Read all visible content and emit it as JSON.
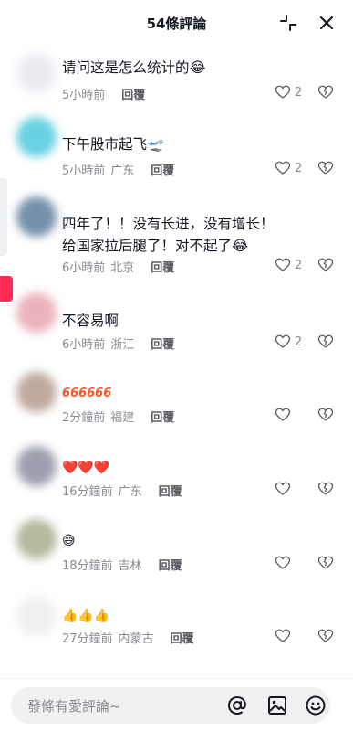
{
  "header": {
    "title": "54條評論"
  },
  "comments": [
    {
      "text": "请问这是怎么统计的😂",
      "time": "5小時前",
      "location": "",
      "reply": "回覆",
      "likes": "2",
      "avatar_color": "#e7e9ee"
    },
    {
      "text": "下午股市起飞🛫",
      "time": "5小時前",
      "location": "广东",
      "reply": "回覆",
      "likes": "2",
      "avatar_color": "#4fc9de"
    },
    {
      "text": "四年了！！没有长进，没有增长！给国家拉后腿了！对不起了😂",
      "time": "6小時前",
      "location": "北京",
      "reply": "回覆",
      "likes": "2",
      "avatar_color": "#5b7d9a"
    },
    {
      "text": "不容易啊",
      "time": "6小時前",
      "location": "浙江",
      "reply": "回覆",
      "likes": "2",
      "avatar_color": "#e8a6b0"
    },
    {
      "text": "666666",
      "time": "2分鐘前",
      "location": "福建",
      "reply": "回覆",
      "likes": "",
      "avatar_color": "#b49b8e"
    },
    {
      "text": "❤️❤️❤️",
      "time": "16分鐘前",
      "location": "广东",
      "reply": "回覆",
      "likes": "",
      "avatar_color": "#8c8fa0"
    },
    {
      "text": "😅",
      "time": "18分鐘前",
      "location": "吉林",
      "reply": "回覆",
      "likes": "",
      "avatar_color": "#a7ae8d"
    },
    {
      "text": "👍👍👍",
      "time": "27分鐘前",
      "location": "内蒙古",
      "reply": "回覆",
      "likes": "",
      "avatar_color": "#eceef0"
    }
  ],
  "input": {
    "placeholder": "發條有愛評論~"
  },
  "colors": {
    "accent": "#fe2c55",
    "muted": "#8a8b91"
  }
}
